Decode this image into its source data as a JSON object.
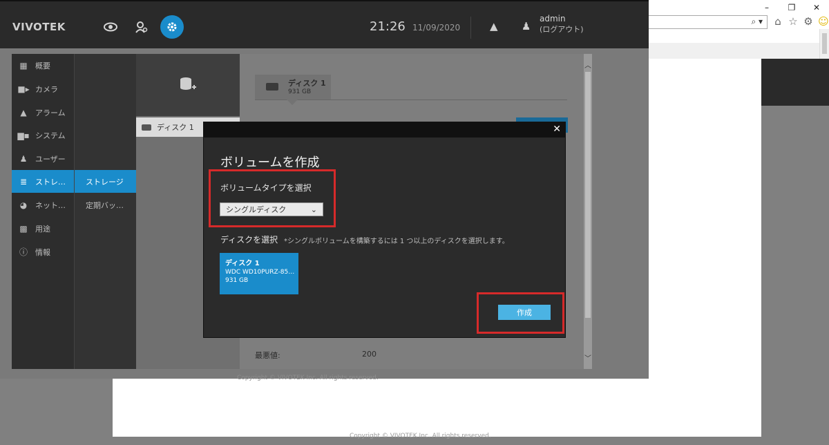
{
  "browser": {
    "win_controls": [
      "–",
      "❐",
      "✕"
    ],
    "search_glyph": "⌕ ▾",
    "icons": [
      "home-icon",
      "star-icon",
      "gear-icon",
      "smiley-icon"
    ]
  },
  "header": {
    "logo": "VIVOTEK",
    "time": "21:26",
    "date": "11/09/2020",
    "user": "admin",
    "logout": "(ログアウト)"
  },
  "sidebar": {
    "items": [
      {
        "label": "概要",
        "icon": "overview-icon"
      },
      {
        "label": "カメラ",
        "icon": "camera-icon"
      },
      {
        "label": "アラーム",
        "icon": "alarm-icon"
      },
      {
        "label": "システム",
        "icon": "system-icon"
      },
      {
        "label": "ユーザー",
        "icon": "user-icon"
      },
      {
        "label": "ストレ…",
        "icon": "storage-icon",
        "active": true
      },
      {
        "label": "ネット…",
        "icon": "network-icon"
      },
      {
        "label": "用途",
        "icon": "apps-icon"
      },
      {
        "label": "情報",
        "icon": "info-icon"
      }
    ]
  },
  "subnav": {
    "items": [
      {
        "label": "ストレージ",
        "active": true
      },
      {
        "label": "定期バッ…"
      }
    ]
  },
  "storage": {
    "disk_list_item": "ディスク 1",
    "tab_name": "ディスク 1",
    "tab_size": "931 GB",
    "worst_label": "最悪値:",
    "worst_value": "200",
    "copyright": "Copyright © VIVOTEK Inc. All rights reserved."
  },
  "modal": {
    "title": "ボリュームを作成",
    "type_label": "ボリュームタイプを選択",
    "type_value": "シングルディスク",
    "disk_label": "ディスクを選択",
    "disk_hint": "*シングルボリュームを構築するには 1 つ以上のディスクを選択します。",
    "disk_card": {
      "name": "ディスク 1",
      "model": "WDC WD10PURZ-85…",
      "size": "931 GB"
    },
    "create_label": "作成",
    "close_glyph": "✕"
  },
  "background_page": {
    "copyright": "Copyright © VIVOTEK Inc. All rights reserved."
  },
  "colors": {
    "accent": "#1a8ccb",
    "create_button": "#4bb3e3",
    "highlight": "#d62a2a"
  }
}
